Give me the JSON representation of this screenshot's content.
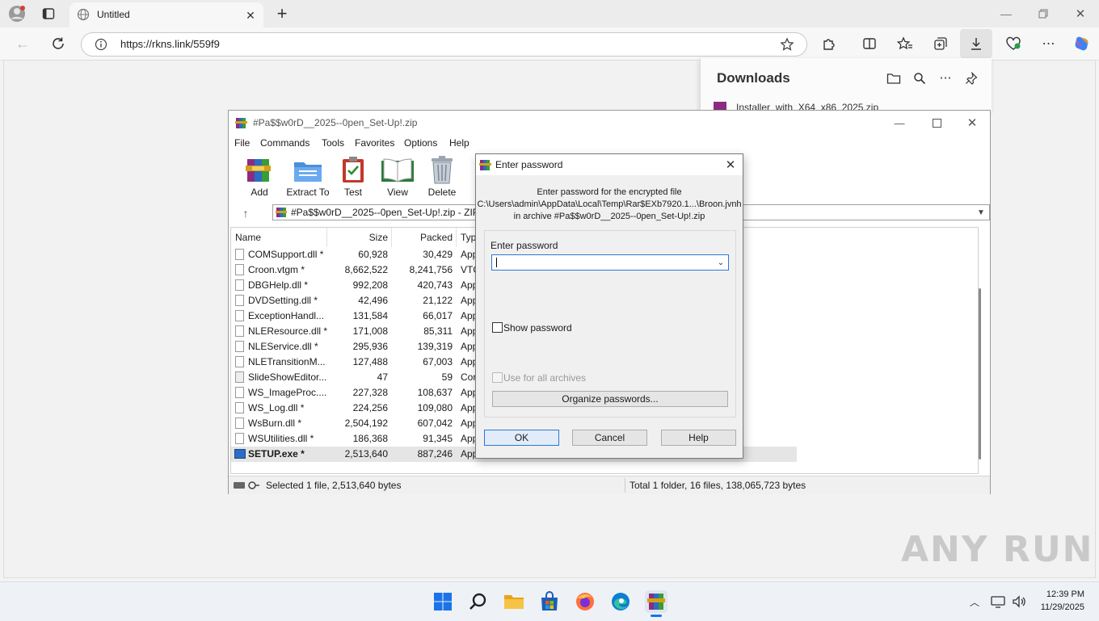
{
  "browser": {
    "tab_title": "Untitled",
    "url": "https://rkns.link/559f9",
    "new_tab_glyph": "+"
  },
  "downloads": {
    "title": "Downloads",
    "item_name": "Installer_with_X64_x86_2025.zip"
  },
  "winrar": {
    "title": "#Pa$$w0rD__2025--0pen_Set-Up!.zip",
    "menu": [
      "File",
      "Commands",
      "Tools",
      "Favorites",
      "Options",
      "Help"
    ],
    "tools": [
      "Add",
      "Extract To",
      "Test",
      "View",
      "Delete"
    ],
    "path": "#Pa$$w0rD__2025--0pen_Set-Up!.zip - ZIP a",
    "columns": {
      "name": "Name",
      "size": "Size",
      "packed": "Packed",
      "type": "Typ"
    },
    "files": [
      {
        "name": "COMSupport.dll *",
        "size": "60,928",
        "packed": "30,429",
        "type": "App"
      },
      {
        "name": "Croon.vtgm *",
        "size": "8,662,522",
        "packed": "8,241,756",
        "type": "VTG"
      },
      {
        "name": "DBGHelp.dll *",
        "size": "992,208",
        "packed": "420,743",
        "type": "App"
      },
      {
        "name": "DVDSetting.dll *",
        "size": "42,496",
        "packed": "21,122",
        "type": "App"
      },
      {
        "name": "ExceptionHandl...",
        "size": "131,584",
        "packed": "66,017",
        "type": "App"
      },
      {
        "name": "NLEResource.dll *",
        "size": "171,008",
        "packed": "85,311",
        "type": "App"
      },
      {
        "name": "NLEService.dll *",
        "size": "295,936",
        "packed": "139,319",
        "type": "App"
      },
      {
        "name": "NLETransitionM...",
        "size": "127,488",
        "packed": "67,003",
        "type": "App"
      },
      {
        "name": "SlideShowEditor...",
        "size": "47",
        "packed": "59",
        "type": "Cor"
      },
      {
        "name": "WS_ImageProc....",
        "size": "227,328",
        "packed": "108,637",
        "type": "App"
      },
      {
        "name": "WS_Log.dll *",
        "size": "224,256",
        "packed": "109,080",
        "type": "App"
      },
      {
        "name": "WsBurn.dll *",
        "size": "2,504,192",
        "packed": "607,042",
        "type": "App"
      },
      {
        "name": "WSUtilities.dll *",
        "size": "186,368",
        "packed": "91,345",
        "type": "App"
      },
      {
        "name": "SETUP.exe *",
        "size": "2,513,640",
        "packed": "887,246",
        "type": "Appl"
      }
    ],
    "status_left": "Selected 1 file, 2,513,640 bytes",
    "status_right": "Total 1 folder, 16 files, 138,065,723 bytes"
  },
  "dialog": {
    "title": "Enter password",
    "message_line1": "Enter password for the encrypted file",
    "message_line2": "C:\\Users\\admin\\AppData\\Local\\Temp\\Rar$EXb7920.1...\\Broon.jvnh",
    "message_line3": "in archive #Pa$$w0rD__2025--0pen_Set-Up!.zip",
    "field_label": "Enter password",
    "password_value": "",
    "show_password": "Show password",
    "use_all": "Use for all archives",
    "organize": "Organize passwords...",
    "ok": "OK",
    "cancel": "Cancel",
    "help": "Help"
  },
  "watermark": "ANY RUN",
  "taskbar": {
    "time": "12:39 PM",
    "date": "11/29/2025"
  }
}
